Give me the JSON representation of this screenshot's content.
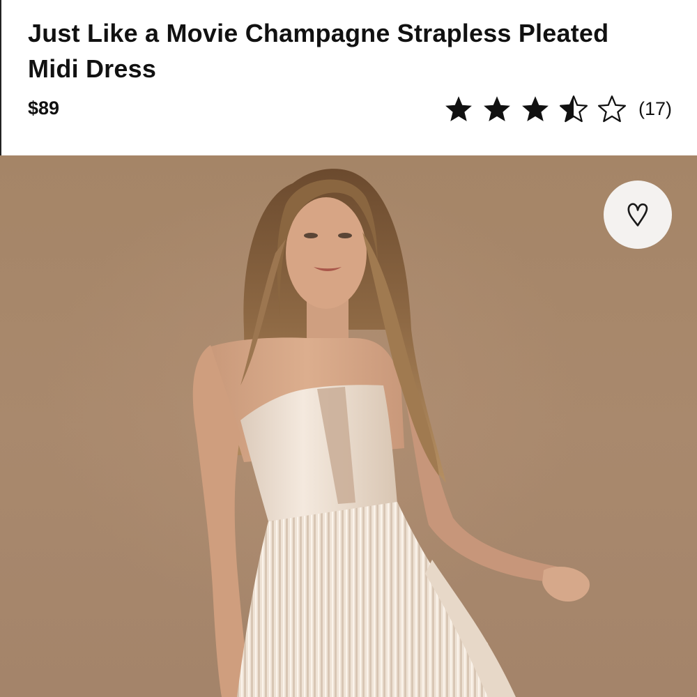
{
  "product": {
    "title": "Just Like a Movie Champagne Strapless Pleated Midi Dress",
    "price": "$89",
    "rating": {
      "value": 3.5,
      "max": 5,
      "count_label": "(17)"
    }
  },
  "favorite": {
    "icon": "heart-icon"
  },
  "colors": {
    "backdrop": "#a8886c",
    "dress": "#efe2d6",
    "star": "#111111"
  }
}
